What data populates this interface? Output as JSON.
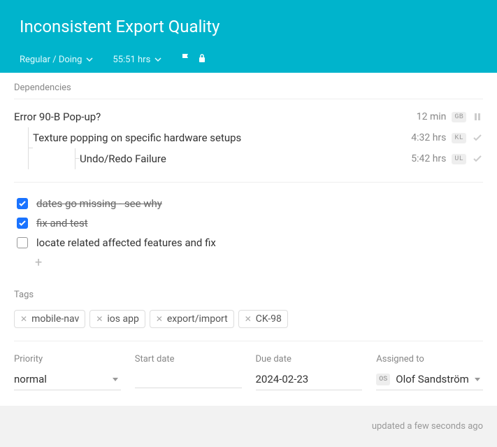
{
  "header": {
    "title": "Inconsistent Export Quality",
    "status": "Regular / Doing",
    "hours": "55:51 hrs"
  },
  "sections": {
    "dependencies_label": "Dependencies",
    "tags_label": "Tags"
  },
  "dependencies": [
    {
      "name": "Error 90-B Pop-up?",
      "time": "12 min",
      "initials": "GB",
      "state": "pause",
      "indent": 0
    },
    {
      "name": "Texture popping on specific hardware setups",
      "time": "4:32 hrs",
      "initials": "KL",
      "state": "done",
      "indent": 1
    },
    {
      "name": "Undo/Redo Failure",
      "time": "5:42 hrs",
      "initials": "UL",
      "state": "done",
      "indent": 2
    }
  ],
  "todos": [
    {
      "label": "dates go missing - see why",
      "done": true
    },
    {
      "label": "fix and test",
      "done": true
    },
    {
      "label": "locate related affected features and fix",
      "done": false
    }
  ],
  "add_symbol": "+",
  "tags": [
    "mobile-nav",
    "ios app",
    "export/import",
    "CK-98"
  ],
  "fields": {
    "priority": {
      "label": "Priority",
      "value": "normal"
    },
    "start": {
      "label": "Start date",
      "value": ""
    },
    "due": {
      "label": "Due date",
      "value": "2024-02-23"
    },
    "assigned": {
      "label": "Assigned to",
      "value": "Olof Sandström",
      "initials": "OS"
    }
  },
  "footer": "updated a few seconds ago"
}
